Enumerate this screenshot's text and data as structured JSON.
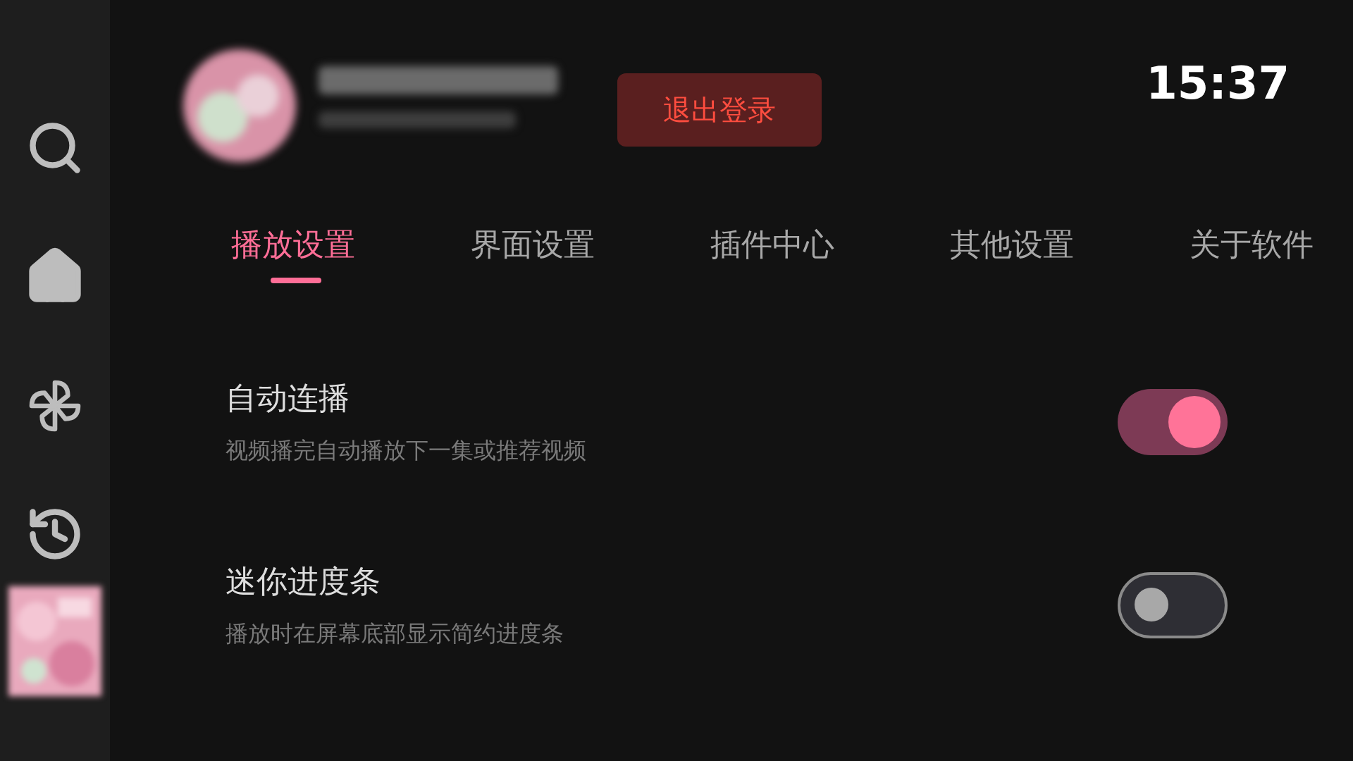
{
  "header": {
    "logout_button": "退出登录",
    "time": "15:37"
  },
  "tabs": [
    {
      "label": "播放设置",
      "selected": true
    },
    {
      "label": "界面设置",
      "selected": false
    },
    {
      "label": "插件中心",
      "selected": false
    },
    {
      "label": "其他设置",
      "selected": false
    },
    {
      "label": "关于软件",
      "selected": false
    }
  ],
  "settings": [
    {
      "title": "自动连播",
      "description": "视频播完自动播放下一集或推荐视频",
      "on": true
    },
    {
      "title": "迷你进度条",
      "description": "播放时在屏幕底部显示简约进度条",
      "on": false
    }
  ]
}
